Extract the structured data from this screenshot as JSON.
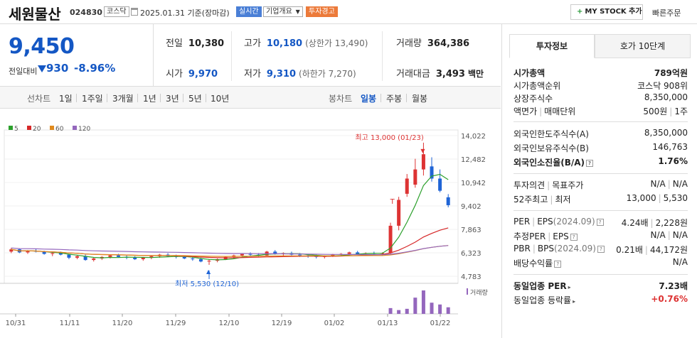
{
  "header": {
    "name": "세원물산",
    "code": "024830",
    "market_badge": "코스닥",
    "date_text": "2025.01.31 기준(장마감)",
    "live_badge": "실시간",
    "overview_badge": "기업개요",
    "warn_badge": "투자경고",
    "mystock_label": "MY STOCK 추가",
    "quick_order": "빠른주문"
  },
  "price": {
    "current": "9,450",
    "change_label": "전일대비",
    "change": "930",
    "change_pct": "-8.96%",
    "color": "#1457c4"
  },
  "stats": {
    "prev_close_label": "전일",
    "prev_close": "10,380",
    "high_label": "고가",
    "high": "10,180",
    "upper_limit": "(상한가 13,490)",
    "volume_label": "거래량",
    "volume": "364,386",
    "open_label": "시가",
    "open": "9,970",
    "low_label": "저가",
    "low": "9,310",
    "lower_limit": "(하한가 7,270)",
    "amount_label": "거래대금",
    "amount": "3,493",
    "amount_unit": "백만"
  },
  "toolbar": {
    "line_chart": "선차트",
    "periods": [
      "1일",
      "1주일",
      "3개월",
      "1년",
      "3년",
      "5년",
      "10년"
    ],
    "candle_chart": "봉차트",
    "candle_periods": [
      "일봉",
      "주봉",
      "월봉"
    ],
    "active_candle": "일봉"
  },
  "chart_data": {
    "type": "line",
    "legend": [
      {
        "name": "5",
        "color": "#2ca02c"
      },
      {
        "name": "20",
        "color": "#d62728"
      },
      {
        "name": "60",
        "color": "#e08a1e"
      },
      {
        "name": "120",
        "color": "#9467bd"
      }
    ],
    "y_ticks": [
      "14,022",
      "12,482",
      "10,942",
      "9,402",
      "7,863",
      "6,323",
      "4,783"
    ],
    "ylim": [
      4783,
      14022
    ],
    "x_ticks": [
      "10/31",
      "11/11",
      "11/20",
      "11/29",
      "12/10",
      "12/19",
      "01/02",
      "01/13",
      "01/22"
    ],
    "annotation_high": "최고 13,000 (01/23)",
    "annotation_low": "최저 5,530 (12/10)",
    "annotation_mark": "T",
    "volume_label": "거래량",
    "candles": [
      [
        6400,
        6650,
        6300,
        6550
      ],
      [
        6550,
        6600,
        6300,
        6350
      ],
      [
        6350,
        6500,
        6250,
        6450
      ],
      [
        6450,
        6600,
        6350,
        6400
      ],
      [
        6400,
        6450,
        6200,
        6250
      ],
      [
        6250,
        6350,
        6100,
        6300
      ],
      [
        6300,
        6400,
        6150,
        6200
      ],
      [
        6200,
        6250,
        5900,
        6000
      ],
      [
        6000,
        6150,
        5900,
        6100
      ],
      [
        6100,
        6200,
        5800,
        5850
      ],
      [
        5850,
        6000,
        5750,
        5950
      ],
      [
        5950,
        6100,
        5850,
        6050
      ],
      [
        6050,
        6200,
        5950,
        6150
      ],
      [
        6150,
        6250,
        6000,
        6050
      ],
      [
        6050,
        6150,
        5900,
        6000
      ],
      [
        6000,
        6100,
        5850,
        5900
      ],
      [
        5900,
        6050,
        5800,
        6000
      ],
      [
        6000,
        6150,
        5900,
        6100
      ],
      [
        6100,
        6250,
        6000,
        6200
      ],
      [
        6200,
        6300,
        6050,
        6100
      ],
      [
        6100,
        6200,
        5950,
        6050
      ],
      [
        6050,
        6150,
        5900,
        5950
      ],
      [
        5950,
        6050,
        5800,
        5900
      ],
      [
        5900,
        6000,
        5700,
        5750
      ],
      [
        5750,
        5900,
        5530,
        5800
      ],
      [
        5800,
        5950,
        5700,
        5900
      ],
      [
        5900,
        6100,
        5850,
        6050
      ],
      [
        6050,
        6200,
        5950,
        6150
      ],
      [
        6150,
        6300,
        6050,
        6250
      ],
      [
        6250,
        6350,
        6100,
        6200
      ],
      [
        6200,
        6300,
        6050,
        6150
      ],
      [
        6150,
        6450,
        6100,
        6400
      ],
      [
        6400,
        6500,
        6200,
        6250
      ],
      [
        6250,
        6350,
        6100,
        6300
      ],
      [
        6300,
        6400,
        6150,
        6200
      ],
      [
        6200,
        6300,
        6050,
        6150
      ],
      [
        6150,
        6250,
        6000,
        6100
      ],
      [
        6100,
        6200,
        5950,
        6050
      ],
      [
        6050,
        6150,
        5950,
        6100
      ],
      [
        6100,
        6250,
        6050,
        6200
      ],
      [
        6200,
        6300,
        6100,
        6250
      ],
      [
        6250,
        6400,
        6150,
        6350
      ],
      [
        6350,
        6450,
        6200,
        6250
      ],
      [
        6250,
        6350,
        6150,
        6300
      ],
      [
        6300,
        6400,
        6200,
        6250
      ],
      [
        6250,
        6350,
        6150,
        6300
      ],
      [
        6300,
        8300,
        6250,
        8100
      ],
      [
        8100,
        10000,
        7800,
        9800
      ],
      [
        10200,
        11500,
        10000,
        11200
      ],
      [
        10800,
        12500,
        10600,
        11800
      ],
      [
        11800,
        13000,
        11400,
        12800
      ],
      [
        12000,
        12600,
        11000,
        11200
      ],
      [
        11200,
        11800,
        10300,
        10400
      ],
      [
        9970,
        10180,
        9310,
        9450
      ]
    ],
    "volumes": [
      0,
      0,
      0,
      0,
      0,
      0,
      0,
      0,
      0,
      0,
      0,
      0,
      0,
      0,
      0,
      0,
      0,
      0,
      0,
      0,
      0,
      0,
      0,
      0,
      0,
      0,
      0,
      0,
      0,
      0,
      0,
      0,
      0,
      0,
      0,
      0,
      0,
      0,
      0,
      0,
      0,
      0,
      0,
      0,
      0,
      0,
      320000,
      210000,
      280000,
      900000,
      1300000,
      620000,
      520000,
      364386
    ]
  },
  "right": {
    "tab_invest": "투자정보",
    "tab_hoga": "호가 10단계",
    "market_cap_label": "시가총액",
    "market_cap": "789억원",
    "market_cap_rank_label": "시가총액순위",
    "market_cap_rank": "코스닥 908위",
    "shares_label": "상장주식수",
    "shares": "8,350,000",
    "par_label": "액면가",
    "unit_label": "매매단위",
    "par": "500원",
    "unit": "1주",
    "foreign_limit_label": "외국인한도주식수(A)",
    "foreign_limit": "8,350,000",
    "foreign_hold_label": "외국인보유주식수(B)",
    "foreign_hold": "146,763",
    "foreign_ratio_label": "외국인소진율(B/A)",
    "foreign_ratio": "1.76%",
    "opinion_label": "투자의견",
    "target_label": "목표주가",
    "opinion": "N/A",
    "target": "N/A",
    "w52_label": "52주최고",
    "w52_low_label": "최저",
    "w52_high": "13,000",
    "w52_low": "5,530",
    "per_label": "PER",
    "eps_label": "EPS",
    "eps_period": "(2024.09)",
    "per": "4.24배",
    "eps": "2,228원",
    "est_per_label": "추정PER",
    "est_eps_label": "EPS",
    "est_per": "N/A",
    "est_eps": "N/A",
    "pbr_label": "PBR",
    "bps_label": "BPS",
    "bps_period": "(2024.09)",
    "pbr": "0.21배",
    "bps": "44,172원",
    "div_label": "배당수익률",
    "div": "N/A",
    "ind_per_label": "동일업종 PER",
    "ind_per": "7.23배",
    "ind_chg_label": "동일업종 등락률",
    "ind_chg": "+0.76%",
    "q_mark": "?"
  }
}
